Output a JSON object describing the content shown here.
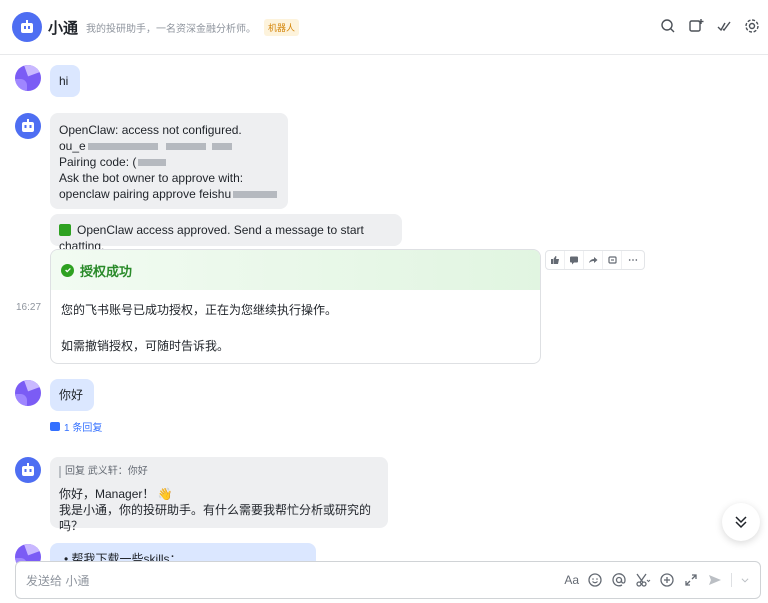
{
  "header": {
    "title": "小通",
    "description": "我的投研助手，一名资深金融分析师。",
    "tag": "机器人"
  },
  "messages": {
    "m1": {
      "text": "hi"
    },
    "m2": {
      "line1": "OpenClaw: access not configured.",
      "line2": "ou_e",
      "line3": "Pairing code: (",
      "line4": "Ask the bot owner to approve with:",
      "line5": "openclaw pairing approve feishu"
    },
    "m3": {
      "text": "OpenClaw access approved. Send a message to start chatting."
    },
    "card": {
      "title": "授权成功",
      "body1": "您的飞书账号已成功授权，正在为您继续执行操作。",
      "body2": "如需撤销授权，可随时告诉我。"
    },
    "time": "16:27",
    "m4": {
      "text": "你好"
    },
    "reply_count": "1 条回复",
    "m5": {
      "quote": "回复 武义轩：你好",
      "line1": "你好，Manager！ 👋",
      "line2": "我是小通，你的投研助手。有什么需要我帮忙分析或研究的吗？"
    },
    "m6": {
      "text": "• 帮我下载一些skills："
    }
  },
  "composer": {
    "placeholder": "发送给 小通",
    "font_label": "Aa"
  },
  "colors": {
    "accent": "#3370ff",
    "user_bubble": "#dbe7ff",
    "bot_bubble": "#eeeff1",
    "success": "#2ea121"
  }
}
